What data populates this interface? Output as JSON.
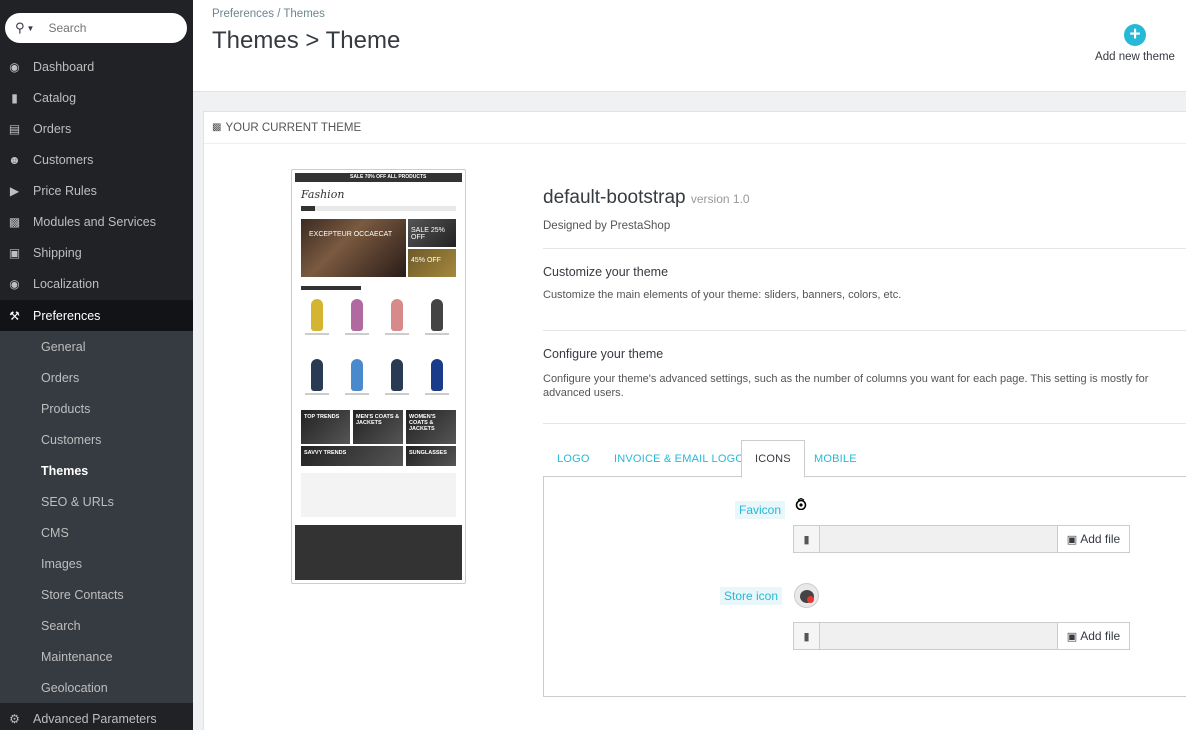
{
  "sidebar": {
    "search_placeholder": "Search",
    "items": [
      {
        "label": "Dashboard",
        "icon": "dashboard-icon"
      },
      {
        "label": "Catalog",
        "icon": "book-icon"
      },
      {
        "label": "Orders",
        "icon": "credit-card-icon"
      },
      {
        "label": "Customers",
        "icon": "users-icon"
      },
      {
        "label": "Price Rules",
        "icon": "tags-icon"
      },
      {
        "label": "Modules and Services",
        "icon": "puzzle-icon"
      },
      {
        "label": "Shipping",
        "icon": "truck-icon"
      },
      {
        "label": "Localization",
        "icon": "globe-icon"
      },
      {
        "label": "Preferences",
        "icon": "wrench-icon"
      }
    ],
    "subitems": [
      "General",
      "Orders",
      "Products",
      "Customers",
      "Themes",
      "SEO & URLs",
      "CMS",
      "Images",
      "Store Contacts",
      "Search",
      "Maintenance",
      "Geolocation"
    ],
    "last_item": {
      "label": "Advanced Parameters",
      "icon": "cogs-icon"
    }
  },
  "header": {
    "breadcrumb": "Preferences  /  Themes",
    "title": "Themes > Theme",
    "add_new_label": "Add new theme"
  },
  "panel": {
    "heading": "YOUR CURRENT THEME",
    "theme_name": "default-bootstrap",
    "version": "version 1.0",
    "designed_by": "Designed by PrestaShop",
    "customize_title": "Customize your theme",
    "customize_desc": "Customize the main elements of your theme: sliders, banners, colors, etc.",
    "configure_title": "Configure your theme",
    "configure_desc": "Configure your theme's advanced settings, such as the number of columns you want for each page. This setting is mostly for advanced users."
  },
  "preview": {
    "topbar": "SALE 70% OFF ALL PRODUCTS",
    "logo": "Fashion",
    "banner": "EXCEPTEUR OCCAECAT",
    "sale1": "SALE 25% OFF",
    "sale2": "45% OFF",
    "block1": "TOP TRENDS",
    "block2": "MEN'S COATS & JACKETS",
    "block3": "WOMEN'S COATS & JACKETS",
    "block4": "SAVVY TRENDS",
    "block5": "SUNGLASSES"
  },
  "tabs": [
    {
      "label": "LOGO",
      "active": false
    },
    {
      "label": "INVOICE & EMAIL LOGOS",
      "active": false
    },
    {
      "label": "ICONS",
      "active": true
    },
    {
      "label": "MOBILE",
      "active": false
    }
  ],
  "icons_tab": {
    "favicon_label": "Favicon",
    "store_icon_label": "Store icon",
    "add_file_label": "Add file"
  },
  "colors": {
    "accent": "#25b9d7",
    "sidebar_bg": "#202226",
    "submenu_bg": "#363a41"
  }
}
